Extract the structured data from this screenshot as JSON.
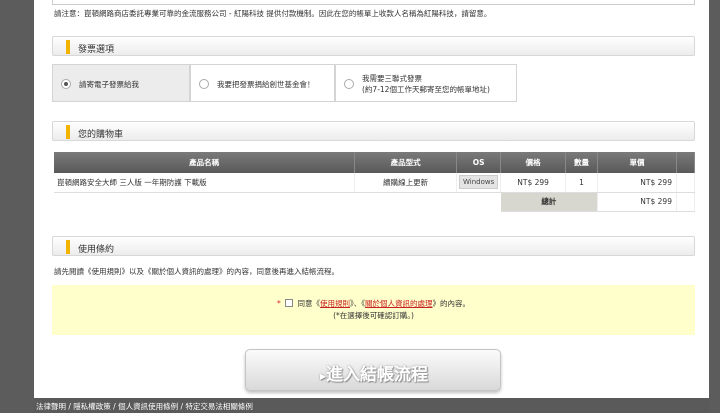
{
  "notice": "請注意：崑頓網路商店委託專業可靠的金流服務公司 - 紅陽科技 提供付款機制。因此在您的帳單上收款人名稱為紅陽科技，請留意。",
  "sections": {
    "invoice": "發票選項",
    "cart": "您的購物車",
    "terms": "使用條約"
  },
  "invoice_options": [
    {
      "label": "請寄電子發票給我",
      "selected": true
    },
    {
      "label": "我要把發票捐給創世基金會！",
      "selected": false
    },
    {
      "label_line1": "我需要三聯式發票",
      "label_line2": "(約7-12個工作天郵寄至您的帳單地址)",
      "selected": false
    }
  ],
  "cart": {
    "headers": [
      "產品名稱",
      "產品型式",
      "OS",
      "價格",
      "數量",
      "單價"
    ],
    "rows": [
      {
        "name": "崑頓網路安全大師 三人版 一年期防護 下載版",
        "type": "續購線上更新",
        "os": "Windows",
        "price": "NT$ 299",
        "qty": "1",
        "unit": "NT$ 299"
      }
    ],
    "total_label": "總計",
    "total_value": "NT$ 299"
  },
  "terms": {
    "intro": "請先閱讀《使用規則》以及《關於個人資訊的處理》的內容，同意後再進入結帳流程。",
    "required_mark": "*",
    "agree_pre": "同意《",
    "link1": "使用規則",
    "agree_mid": "》、《",
    "link2": "關於個人資訊的處理",
    "agree_post": "》的內容。",
    "note": "(*在選擇後可確認訂購。)"
  },
  "checkout_button": "進入結帳流程",
  "checkout_arrow": "▸",
  "footer": "法律聲明 / 隱私權政策 / 個人資訊使用條例 / 特定交易法相關條例"
}
